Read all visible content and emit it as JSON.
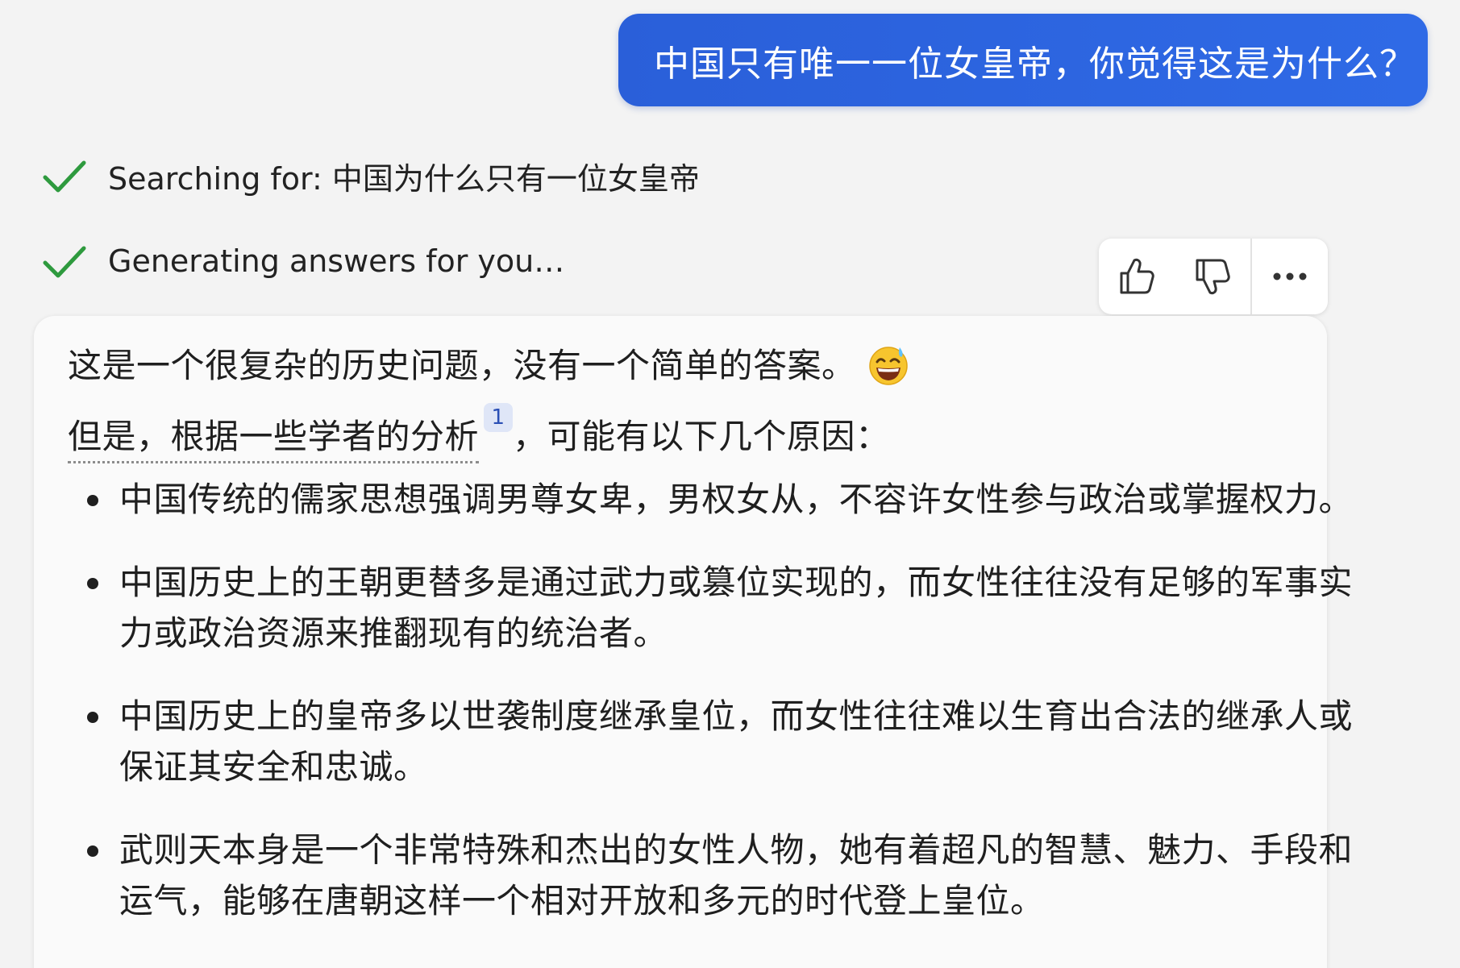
{
  "user_message": "中国只有唯一一位女皇帝，你觉得这是为什么？",
  "status": [
    {
      "icon": "check-icon",
      "text": "Searching for: 中国为什么只有一位女皇帝"
    },
    {
      "icon": "check-icon",
      "text": "Generating answers for you…"
    }
  ],
  "feedback": {
    "like_icon": "thumbs-up-icon",
    "dislike_icon": "thumbs-down-icon",
    "more_icon": "more-options-icon"
  },
  "answer": {
    "intro": "这是一个很复杂的历史问题，没有一个简单的答案。",
    "intro_emoji": "grinning-sweat-emoji",
    "lead_cited": "但是，根据一些学者的分析",
    "citation": "1",
    "lead_rest": "，可能有以下几个原因：",
    "bullets": [
      "中国传统的儒家思想强调男尊女卑，男权女从，不容许女性参与政治或掌握权力。",
      "中国历史上的王朝更替多是通过武力或篡位实现的，而女性往往没有足够的军事实力或政治资源来推翻现有的统治者。",
      "中国历史上的皇帝多以世袭制度继承皇位，而女性往往难以生育出合法的继承人或保证其安全和忠诚。",
      "武则天本身是一个非常特殊和杰出的女性人物，她有着超凡的智慧、魅力、手段和运气，能够在唐朝这样一个相对开放和多元的时代登上皇位。"
    ]
  },
  "colors": {
    "background": "#f3f3f3",
    "user_bubble": "#2f6ae6",
    "check": "#2e9a3e",
    "citation_bg": "#dfe6f7",
    "citation_text": "#2a4fb5"
  }
}
